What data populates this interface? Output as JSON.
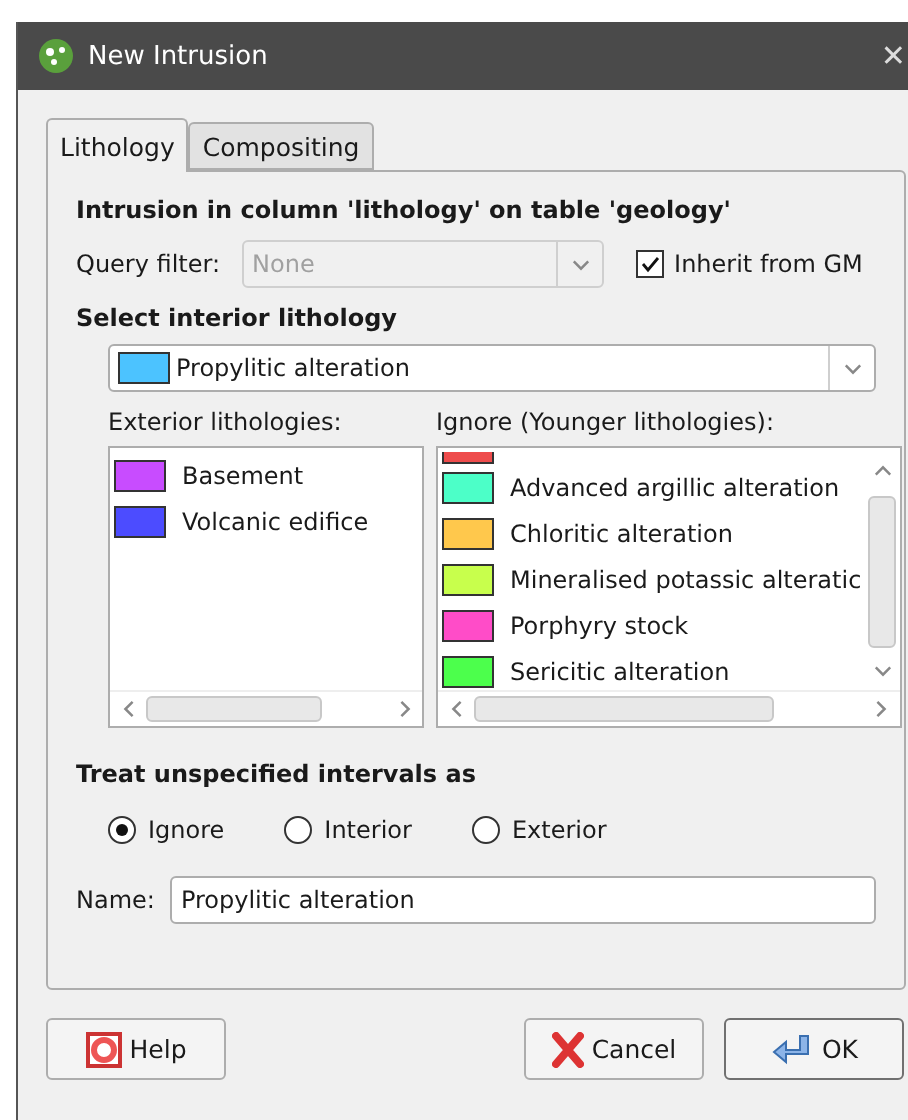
{
  "window": {
    "title": "New Intrusion",
    "close": "✕"
  },
  "tabs": [
    {
      "label": "Lithology",
      "selected": true
    },
    {
      "label": "Compositing",
      "selected": false
    }
  ],
  "heading": "Intrusion in column 'lithology' on table 'geology'",
  "query_filter": {
    "label": "Query filter:",
    "value": "None",
    "disabled": true
  },
  "inherit": {
    "label": "Inherit from GM",
    "checked": true
  },
  "interior": {
    "label": "Select interior lithology",
    "value": "Propylitic alteration",
    "color": "#4cc3ff"
  },
  "exterior": {
    "label": "Exterior lithologies:",
    "items": [
      {
        "name": "Basement",
        "color": "#c84cff"
      },
      {
        "name": "Volcanic edifice",
        "color": "#4c4cff"
      }
    ]
  },
  "ignore": {
    "label": "Ignore (Younger lithologies):",
    "items": [
      {
        "color": "#ee4c4c",
        "clipped": true
      },
      {
        "name": "Advanced argillic alteration",
        "color": "#4cffc8",
        "clipped": false
      },
      {
        "name": "Chloritic alteration",
        "color": "#ffc84c",
        "clipped": false
      },
      {
        "name": "Mineralised potassic alteratic",
        "color": "#c8ff4c",
        "clipped": false
      },
      {
        "name": "Porphyry stock",
        "color": "#ff4cc8",
        "clipped": false
      },
      {
        "name": "Sericitic alteration",
        "color": "#4cff4c",
        "clipped": false
      }
    ]
  },
  "unspecified": {
    "label": "Treat unspecified intervals as",
    "options": [
      {
        "label": "Ignore",
        "selected": true
      },
      {
        "label": "Interior",
        "selected": false
      },
      {
        "label": "Exterior",
        "selected": false
      }
    ]
  },
  "name": {
    "label": "Name:",
    "value": "Propylitic alteration"
  },
  "buttons": [
    {
      "kind": "help",
      "label": "Help"
    },
    {
      "kind": "cancel",
      "label": "Cancel"
    },
    {
      "kind": "ok",
      "label": "OK"
    }
  ]
}
